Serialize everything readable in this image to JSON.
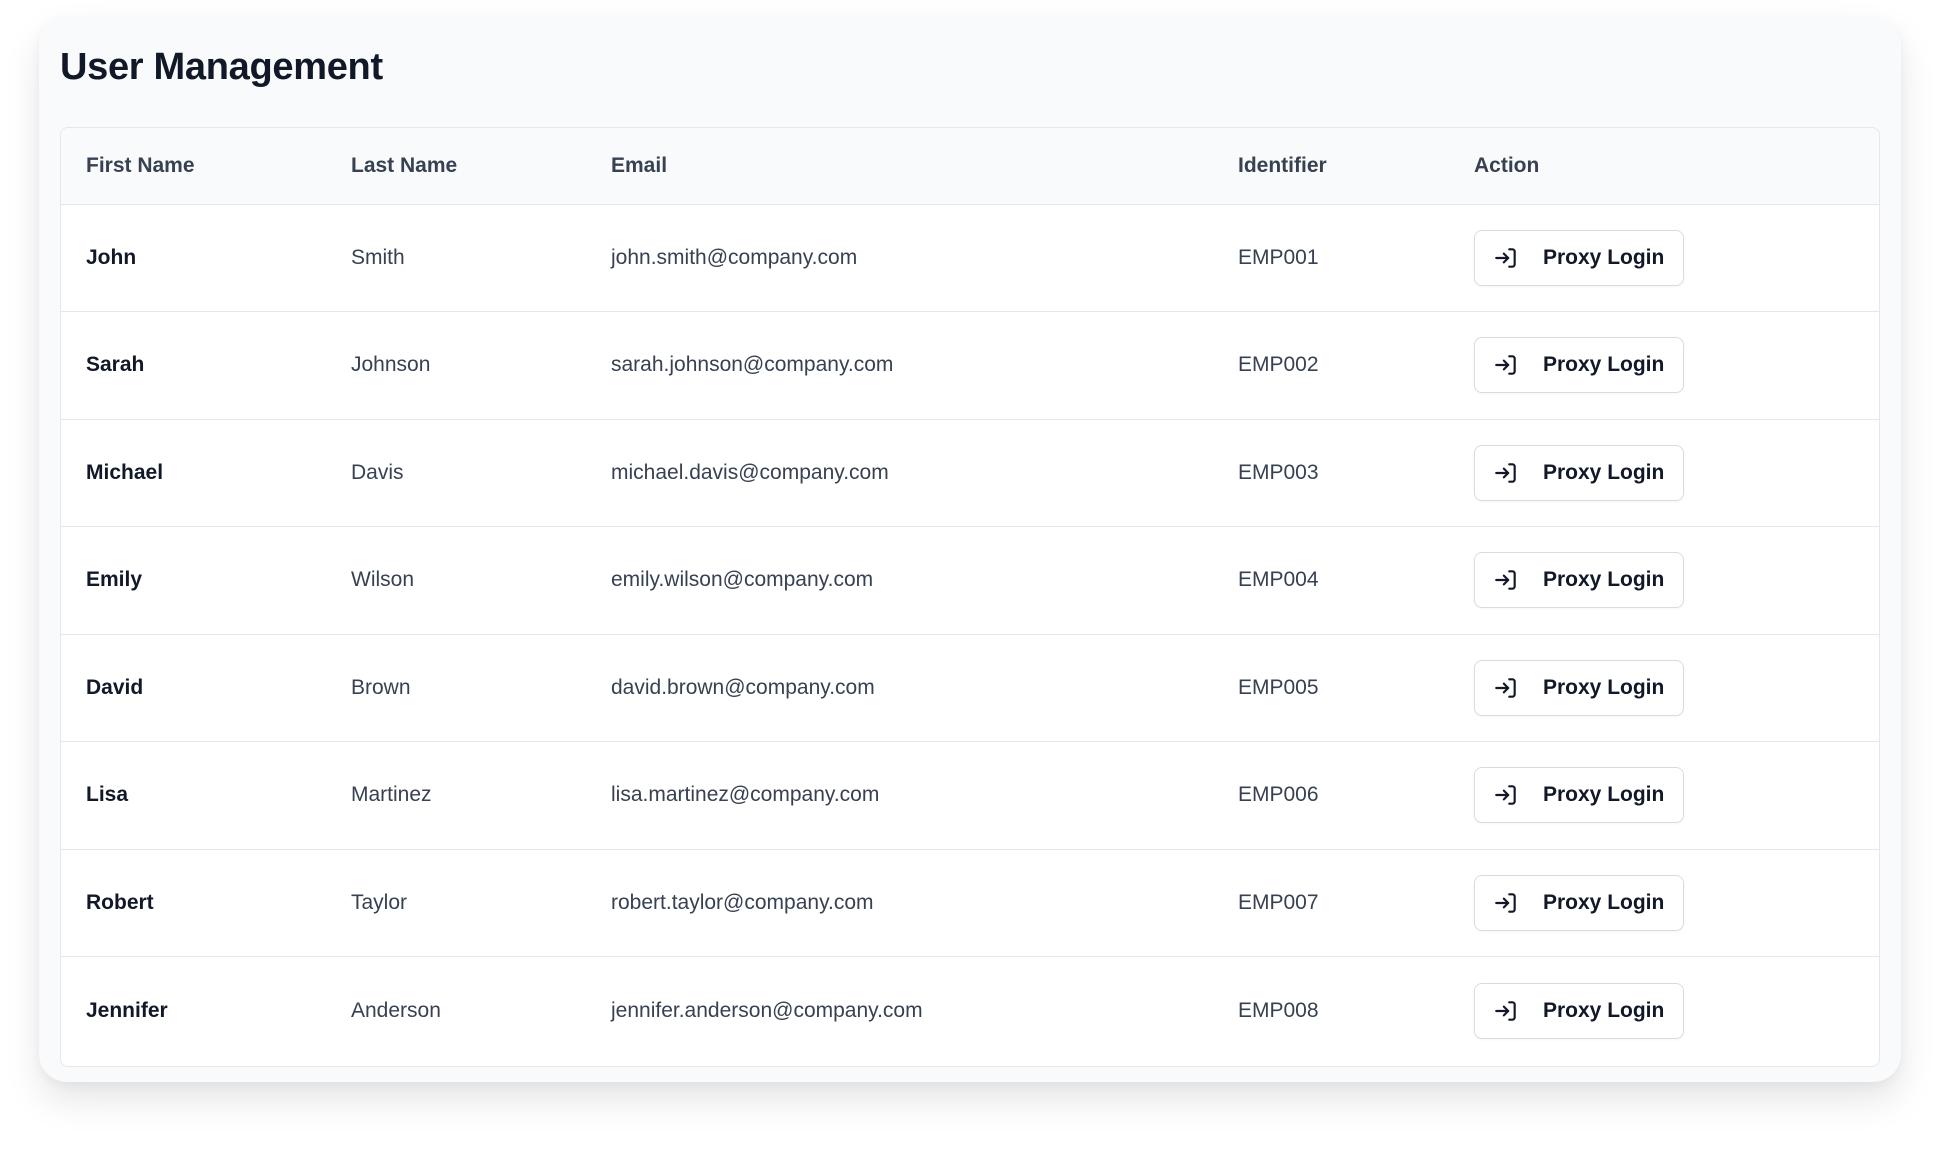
{
  "page": {
    "title": "User Management"
  },
  "table": {
    "columns": [
      "First Name",
      "Last Name",
      "Email",
      "Identifier",
      "Action"
    ],
    "action_label": "Proxy Login",
    "action_icon": "log-in-icon",
    "rows": [
      {
        "first_name": "John",
        "last_name": "Smith",
        "email": "john.smith@company.com",
        "identifier": "EMP001"
      },
      {
        "first_name": "Sarah",
        "last_name": "Johnson",
        "email": "sarah.johnson@company.com",
        "identifier": "EMP002"
      },
      {
        "first_name": "Michael",
        "last_name": "Davis",
        "email": "michael.davis@company.com",
        "identifier": "EMP003"
      },
      {
        "first_name": "Emily",
        "last_name": "Wilson",
        "email": "emily.wilson@company.com",
        "identifier": "EMP004"
      },
      {
        "first_name": "David",
        "last_name": "Brown",
        "email": "david.brown@company.com",
        "identifier": "EMP005"
      },
      {
        "first_name": "Lisa",
        "last_name": "Martinez",
        "email": "lisa.martinez@company.com",
        "identifier": "EMP006"
      },
      {
        "first_name": "Robert",
        "last_name": "Taylor",
        "email": "robert.taylor@company.com",
        "identifier": "EMP007"
      },
      {
        "first_name": "Jennifer",
        "last_name": "Anderson",
        "email": "jennifer.anderson@company.com",
        "identifier": "EMP008"
      }
    ]
  },
  "colors": {
    "card_background": "#f9fafb",
    "table_header_background": "#f9fafb",
    "border": "#e5e7eb",
    "text_primary": "#111827",
    "text_secondary": "#374151"
  }
}
